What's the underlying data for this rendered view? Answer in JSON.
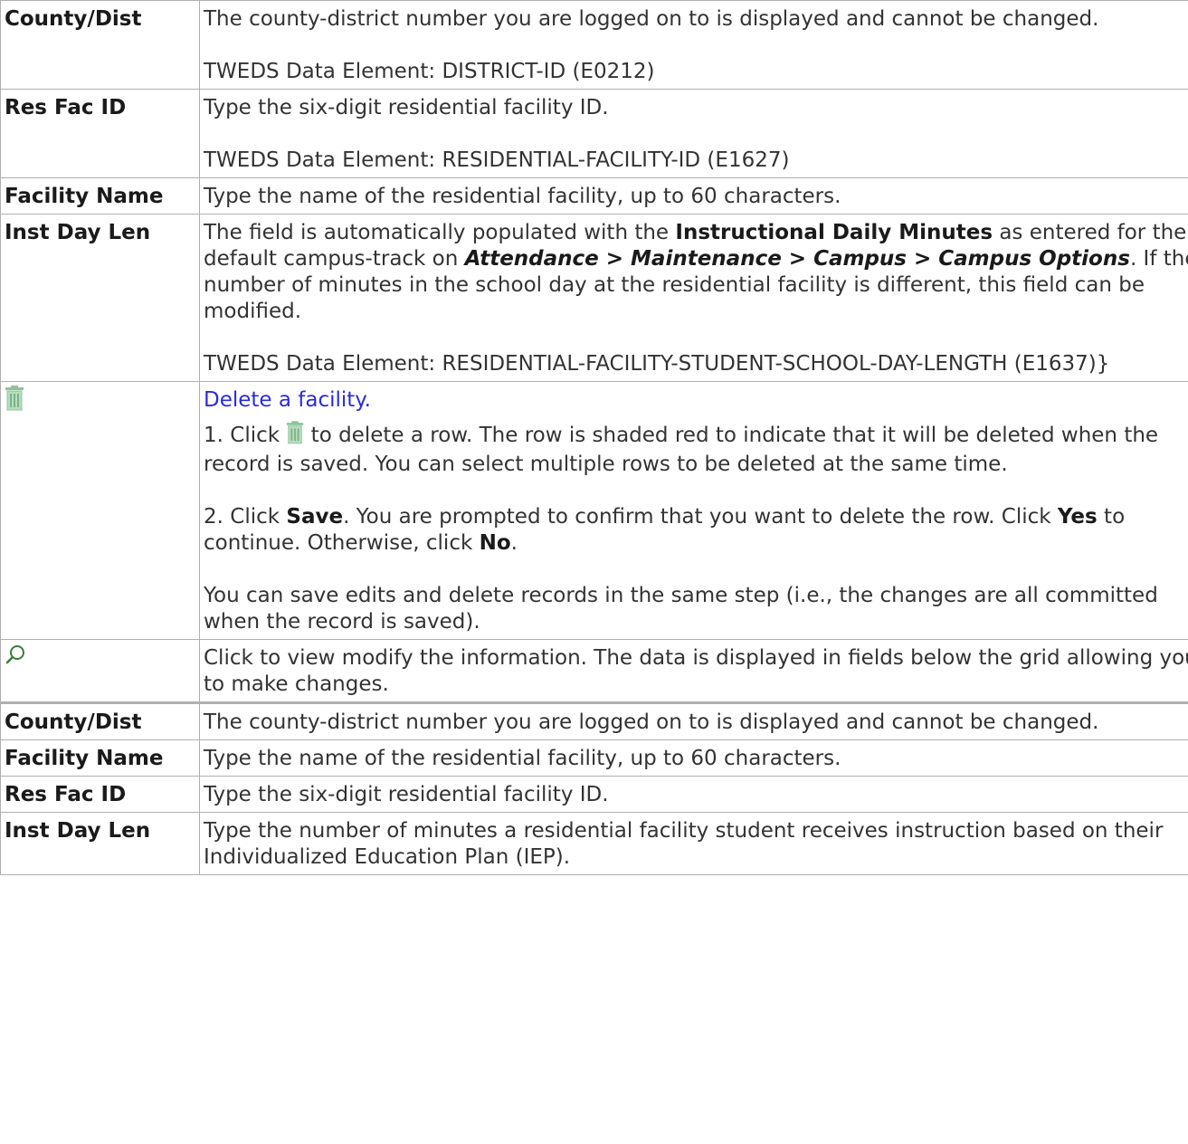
{
  "rows": [
    {
      "term": "County/Dist",
      "desc": "The county-district number you are logged on to is displayed and cannot be changed.",
      "note": "TWEDS Data Element: DISTRICT-ID (E0212)"
    },
    {
      "term": "Res Fac ID",
      "desc": "Type the six-digit residential facility ID.",
      "note": "TWEDS Data Element: RESIDENTIAL-FACILITY-ID (E1627)"
    },
    {
      "term": "Facility Name",
      "desc": "Type the name of the residential facility, up to 60 characters."
    },
    {
      "term": "Inst Day Len",
      "desc_p1": "The field is automatically populated with the ",
      "desc_bold": "Instructional Daily Minutes",
      "desc_p2": " as entered for the default campus-track on ",
      "desc_path": "Attendance > Maintenance > Campus > Campus Options",
      "desc_p3": ". If the number of minutes in the school day at the residential facility is different, this field can be modified.",
      "note": "TWEDS Data Element: RESIDENTIAL-FACILITY-STUDENT-SCHOOL-DAY-LENGTH (E1637)}"
    }
  ],
  "delete": {
    "icon": "trash-icon",
    "link": "Delete a facility.",
    "step1_a": "1. Click ",
    "step1_b": " to delete a row. The row is shaded red to indicate that it will be deleted when the record is saved. You can select multiple rows to be deleted at the same time.",
    "step2_a": "2. Click ",
    "step2_save": "Save",
    "step2_b": ". You are prompted to confirm that you want to delete the row. Click ",
    "step2_yes": "Yes",
    "step2_c": " to continue. Otherwise, click ",
    "step2_no": "No",
    "step2_d": ".",
    "note": "You can save edits and delete records in the same step (i.e., the changes are all committed when the record is saved)."
  },
  "view": {
    "icon": "search-icon",
    "desc": "Click to view modify the information. The data is displayed in fields below the grid allowing you to make changes."
  },
  "detail_rows": [
    {
      "term": "County/Dist",
      "desc": "The county-district number you are logged on to is displayed and cannot be changed."
    },
    {
      "term": "Facility Name",
      "desc": "Type the name of the residential facility, up to 60 characters."
    },
    {
      "term": "Res Fac ID",
      "desc": "Type the six-digit residential facility ID."
    },
    {
      "term": "Inst Day Len",
      "desc": "Type the number of minutes a residential facility student receives instruction based on their Individualized Education Plan (IEP)."
    }
  ],
  "colors": {
    "border": "#b0b0b0",
    "link": "#2b2bdd",
    "trash_icon": "#8fc49a",
    "search_icon": "#3a7d3a"
  }
}
